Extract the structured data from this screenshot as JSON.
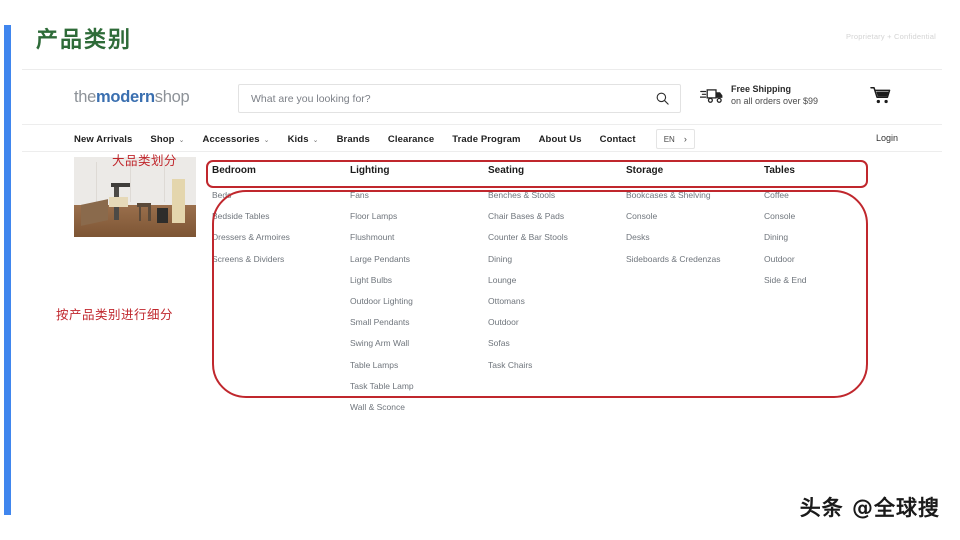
{
  "slide": {
    "title": "产品类别",
    "proprietary": "Proprietary + Confidential",
    "watermark": "头条 @全球搜"
  },
  "site": {
    "logo": {
      "part1": "the",
      "part2": "modern",
      "part3": "shop"
    },
    "search": {
      "placeholder": "What are you looking for?",
      "value": "",
      "icon": "search-icon"
    },
    "shipping": {
      "icon": "truck-icon",
      "title": "Free Shipping",
      "subtitle": "on all orders over $99"
    },
    "cart": {
      "icon": "cart-icon"
    },
    "nav": {
      "items": [
        {
          "label": "New Arrivals",
          "caret": false
        },
        {
          "label": "Shop",
          "caret": true
        },
        {
          "label": "Accessories",
          "caret": true
        },
        {
          "label": "Kids",
          "caret": true
        },
        {
          "label": "Brands",
          "caret": false
        },
        {
          "label": "Clearance",
          "caret": false
        },
        {
          "label": "Trade Program",
          "caret": false
        },
        {
          "label": "About Us",
          "caret": false
        },
        {
          "label": "Contact",
          "caret": false
        }
      ],
      "language": {
        "code": "EN",
        "arrow": "›"
      },
      "login": "Login"
    },
    "megamenu": {
      "promo_image_alt": "furniture-showroom-photo",
      "columns": [
        {
          "header": "Bedroom",
          "links": [
            "Beds",
            "Bedside Tables",
            "Dressers & Armoires",
            "Screens & Dividers"
          ]
        },
        {
          "header": "Lighting",
          "links": [
            "Fans",
            "Floor Lamps",
            "Flushmount",
            "Large Pendants",
            "Light Bulbs",
            "Outdoor Lighting",
            "Small Pendants",
            "Swing Arm Wall",
            "Table Lamps",
            "Task Table Lamp",
            "Wall & Sconce"
          ]
        },
        {
          "header": "Seating",
          "links": [
            "Benches & Stools",
            "Chair Bases & Pads",
            "Counter & Bar Stools",
            "Dining",
            "Lounge",
            "Ottomans",
            "Outdoor",
            "Sofas",
            "Task Chairs"
          ]
        },
        {
          "header": "Storage",
          "links": [
            "Bookcases & Shelving",
            "Console",
            "Desks",
            "Sideboards & Credenzas"
          ]
        },
        {
          "header": "Tables",
          "links": [
            "Coffee",
            "Console",
            "Dining",
            "Outdoor",
            "Side & End"
          ]
        }
      ]
    }
  },
  "annotations": {
    "top_label": "大品类划分",
    "side_label": "按产品类别进行细分"
  },
  "colors": {
    "accent_blue": "#4086ee",
    "title_green": "#2e6b38",
    "annotation_red": "#c0272d",
    "logo_blue": "#3a6fb0"
  }
}
